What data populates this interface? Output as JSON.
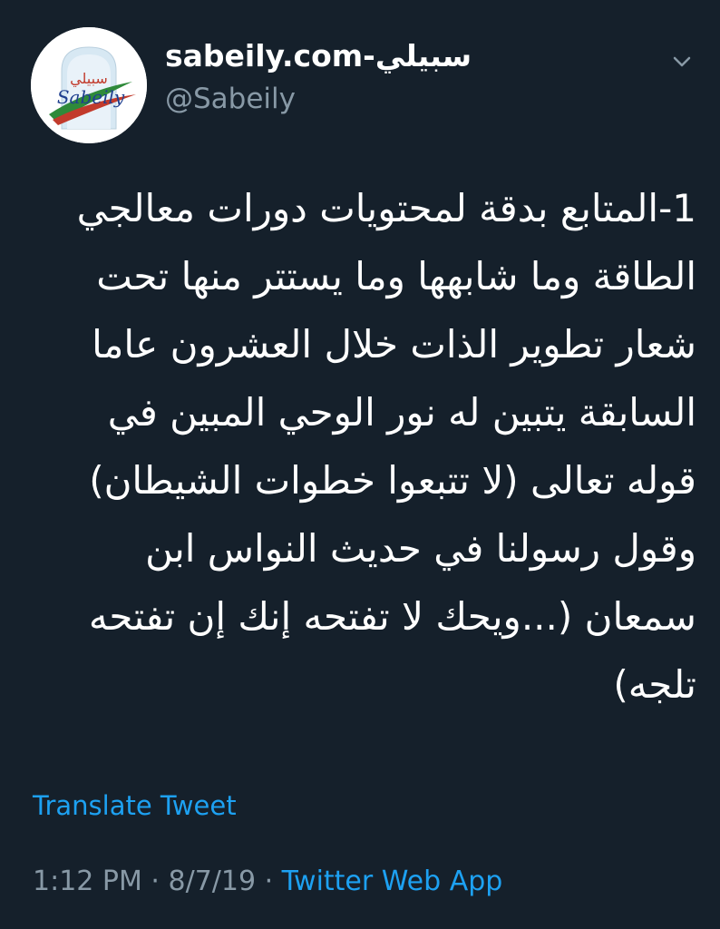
{
  "user": {
    "display_name": "sabeily.com-سبيلي",
    "handle": "@Sabeily",
    "avatar_logo_arabic": "سبيلي",
    "avatar_logo_latin": "Sabeily"
  },
  "tweet": {
    "text": "1-المتابع بدقة لمحتويات دورات معالجي الطاقة وما شابهها وما يستتر منها تحت شعار تطوير الذات خلال العشرون عاما السابقة يتبين له نور الوحي المبين في قوله تعالى (لا تتبعوا خطوات الشيطان) وقول رسولنا في حديث النواس ابن سمعان (...ويحك لا تفتحه إنك إن تفتحه تلجه)",
    "translate_label": "Translate Tweet",
    "time": "1:12 PM",
    "separator1": " · ",
    "date": "8/7/19",
    "separator2": " · ",
    "source": "Twitter Web App"
  },
  "icons": {
    "menu": "chevron-down-icon"
  },
  "colors": {
    "background": "#15202b",
    "text": "#ffffff",
    "secondary": "#8899a6",
    "accent": "#1da1f2"
  }
}
